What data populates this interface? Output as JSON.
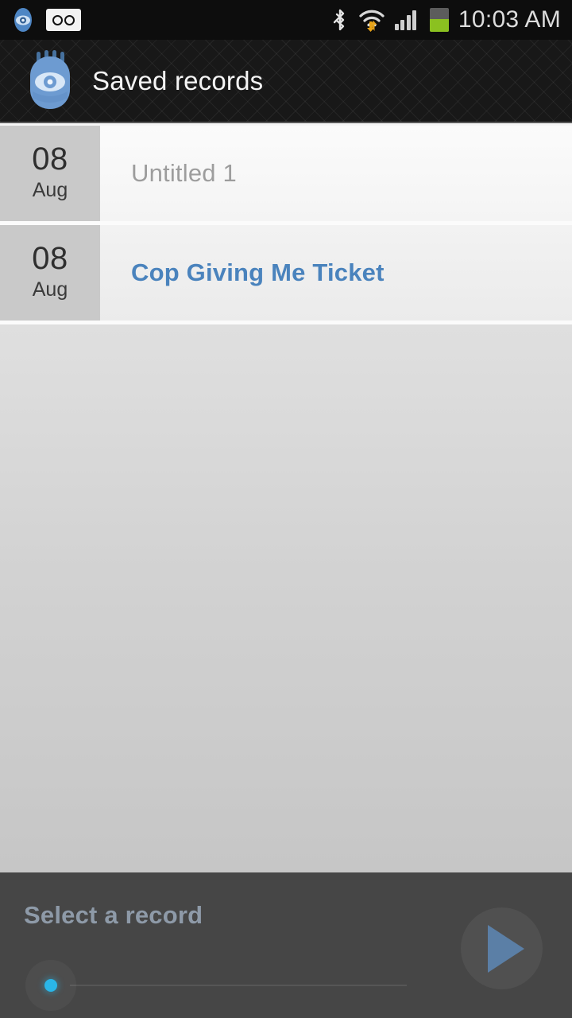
{
  "statusbar": {
    "time": "10:03 AM",
    "left_icons": [
      {
        "name": "app-eye-icon",
        "label": "eye-icon"
      },
      {
        "name": "voicemail-icon",
        "label": "voicemail-icon"
      }
    ],
    "right_icons": [
      {
        "name": "bluetooth-icon",
        "label": "bluetooth-icon"
      },
      {
        "name": "wifi-icon",
        "label": "wifi-icon"
      },
      {
        "name": "signal-icon",
        "label": "signal-icon"
      },
      {
        "name": "battery-icon",
        "label": "battery-icon"
      }
    ],
    "battery_level_percent": 52,
    "signal_bars": 4,
    "colors": {
      "background": "#0d0d0d",
      "time_text": "#dcdcdc",
      "battery_fill": "#8bc120"
    }
  },
  "appbar": {
    "title": "Saved records",
    "icon_name": "hamsa-eye-icon",
    "colors": {
      "background": "#181818",
      "title_text": "#f4f4f4",
      "icon": "#6d9bd1"
    }
  },
  "list": {
    "rows": [
      {
        "day": "08",
        "month": "Aug",
        "title": "Untitled 1",
        "title_style": "placeholder"
      },
      {
        "day": "08",
        "month": "Aug",
        "title": "Cop Giving Me Ticket",
        "title_style": "named"
      }
    ],
    "colors": {
      "date_badge_bg": "#c9c9c9",
      "placeholder_text": "#9d9d9d",
      "named_text": "#4a83bd",
      "divider": "#fbfbfb"
    }
  },
  "player": {
    "label": "Select a record",
    "play_button_name": "play-button",
    "seek_position_percent": 0,
    "colors": {
      "background": "#464646",
      "label_text": "#8e9aa8",
      "thumb": "#2ab6e8",
      "play_triangle": "#5b7fa6"
    }
  }
}
